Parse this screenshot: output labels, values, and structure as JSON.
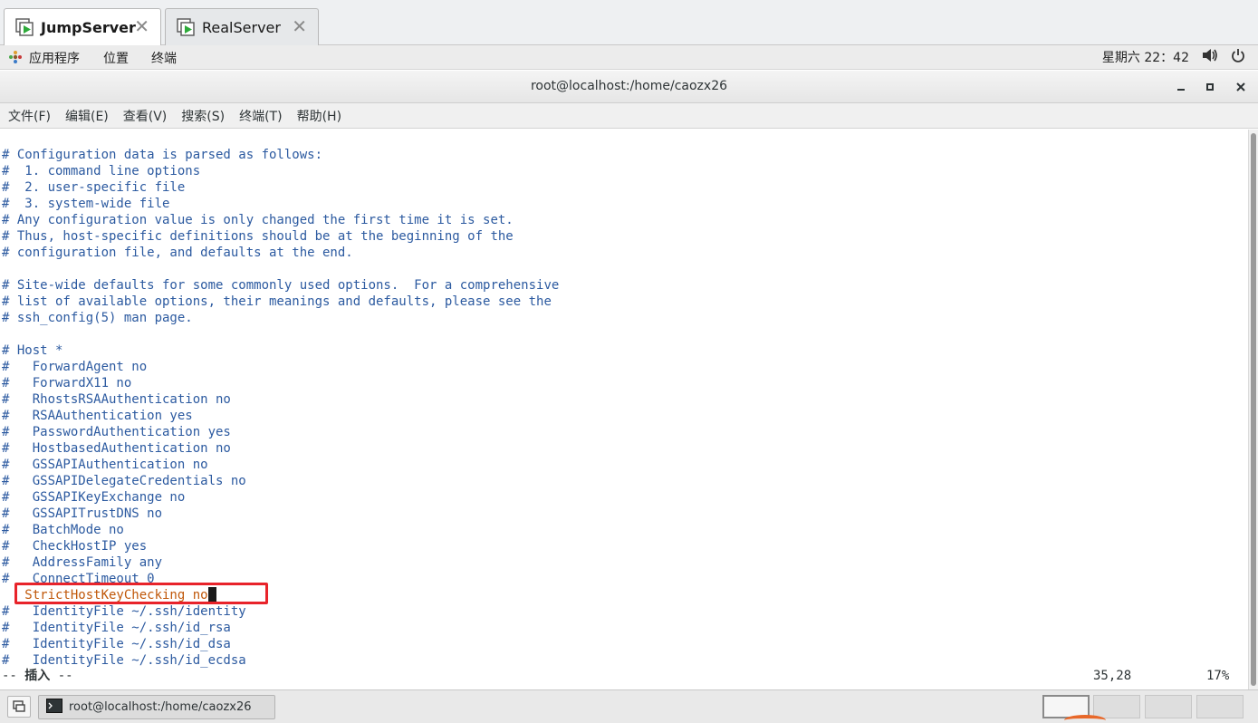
{
  "vm_tabs": [
    {
      "label": "JumpServer",
      "active": true
    },
    {
      "label": "RealServer",
      "active": false
    }
  ],
  "top_panel": {
    "menus": [
      "应用程序",
      "位置",
      "终端"
    ],
    "clock": "星期六 22：42"
  },
  "window": {
    "title": "root@localhost:/home/caozx26"
  },
  "menubar": [
    "文件(F)",
    "编辑(E)",
    "查看(V)",
    "搜索(S)",
    "终端(T)",
    "帮助(H)"
  ],
  "terminal": {
    "lines": [
      "# Configuration data is parsed as follows:",
      "#  1. command line options",
      "#  2. user-specific file",
      "#  3. system-wide file",
      "# Any configuration value is only changed the first time it is set.",
      "# Thus, host-specific definitions should be at the beginning of the",
      "# configuration file, and defaults at the end.",
      "",
      "# Site-wide defaults for some commonly used options.  For a comprehensive",
      "# list of available options, their meanings and defaults, please see the",
      "# ssh_config(5) man page.",
      "",
      "# Host *",
      "#   ForwardAgent no",
      "#   ForwardX11 no",
      "#   RhostsRSAAuthentication no",
      "#   RSAAuthentication yes",
      "#   PasswordAuthentication yes",
      "#   HostbasedAuthentication no",
      "#   GSSAPIAuthentication no",
      "#   GSSAPIDelegateCredentials no",
      "#   GSSAPIKeyExchange no",
      "#   GSSAPITrustDNS no",
      "#   BatchMode no",
      "#   CheckHostIP yes",
      "#   AddressFamily any",
      "#   ConnectTimeout 0",
      "   StrictHostKeyChecking no",
      "#   IdentityFile ~/.ssh/identity",
      "#   IdentityFile ~/.ssh/id_rsa",
      "#   IdentityFile ~/.ssh/id_dsa",
      "#   IdentityFile ~/.ssh/id_ecdsa"
    ],
    "active_line_index": 27,
    "status_mode_prefix": "-- ",
    "status_mode": "插入",
    "status_mode_suffix": " --",
    "cursor_position": "35,28",
    "scroll_percent": "17%",
    "text_color": "#2c5aa0",
    "active_line_color": "#c0580a",
    "highlight_color": "#e8232a"
  },
  "taskbar": {
    "task_label": "root@localhost:/home/caozx26",
    "workspaces": 4,
    "active_workspace": 1
  }
}
